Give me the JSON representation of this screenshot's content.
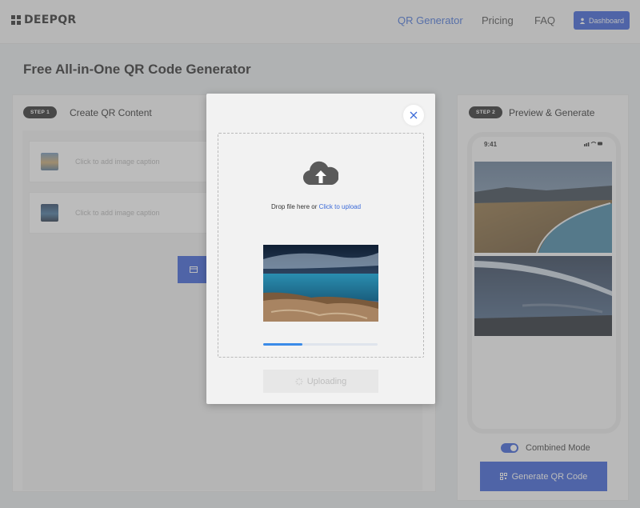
{
  "header": {
    "logo_text": "DEEPQR",
    "nav": [
      "QR Generator",
      "Pricing",
      "FAQ"
    ],
    "active_nav": "QR Generator",
    "dashboard_label": "Dashboard"
  },
  "page": {
    "title": "Free All-in-One QR Code Generator"
  },
  "left_panel": {
    "step_badge": "STEP 1",
    "title": "Create QR Content",
    "image_items": [
      {
        "caption_placeholder": "Click to add image caption"
      },
      {
        "caption_placeholder": "Click to add image caption"
      }
    ]
  },
  "right_panel": {
    "step_badge": "STEP 2",
    "title": "Preview & Generate",
    "phone_time": "9:41",
    "combined_mode_label": "Combined Mode",
    "combined_mode_on": true,
    "generate_label": "Generate QR Code"
  },
  "modal": {
    "drop_text": "Drop file here or",
    "upload_link": "Click to upload",
    "progress": 0.34,
    "uploading_label": "Uploading"
  },
  "colors": {
    "accent": "#2e57d6",
    "link": "#3c6bd8",
    "progress": "#3b8be8"
  }
}
